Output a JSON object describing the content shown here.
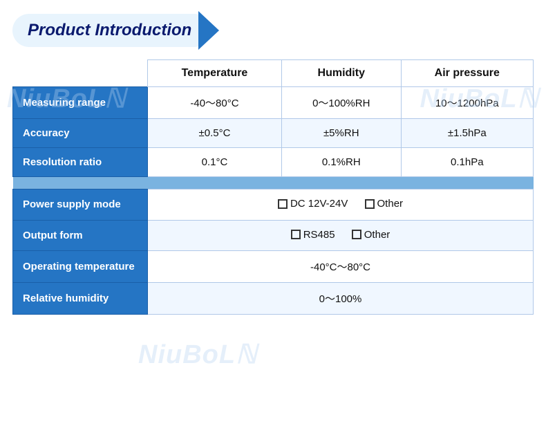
{
  "header": {
    "title": "Product Introduction"
  },
  "watermarks": [
    "NiuBoL",
    "NiuBoL",
    "NiuBoL"
  ],
  "table": {
    "header": {
      "col1_empty": "",
      "col2": "Temperature",
      "col3": "Humidity",
      "col4": "Air pressure"
    },
    "rows": [
      {
        "label": "Measuring range",
        "temp": "-40～80°C",
        "humidity": "0～100%RH",
        "pressure": "10～1200hPa"
      },
      {
        "label": "Accuracy",
        "temp": "±0.5°C",
        "humidity": "±5%RH",
        "pressure": "±1.5hPa"
      },
      {
        "label": "Resolution ratio",
        "temp": "0.1°C",
        "humidity": "0.1%RH",
        "pressure": "0.1hPa"
      }
    ],
    "wide_rows": [
      {
        "label": "Power supply mode",
        "value": "power_supply"
      },
      {
        "label": "Output form",
        "value": "output_form"
      },
      {
        "label": "Operating temperature",
        "value": "-40°C～80°C"
      },
      {
        "label": "Relative humidity",
        "value": "0～100%"
      }
    ]
  },
  "power_supply": {
    "option1_label": "DC 12V-24V",
    "option2_label": "Other"
  },
  "output_form": {
    "option1_label": "RS485",
    "option2_label": "Other"
  }
}
